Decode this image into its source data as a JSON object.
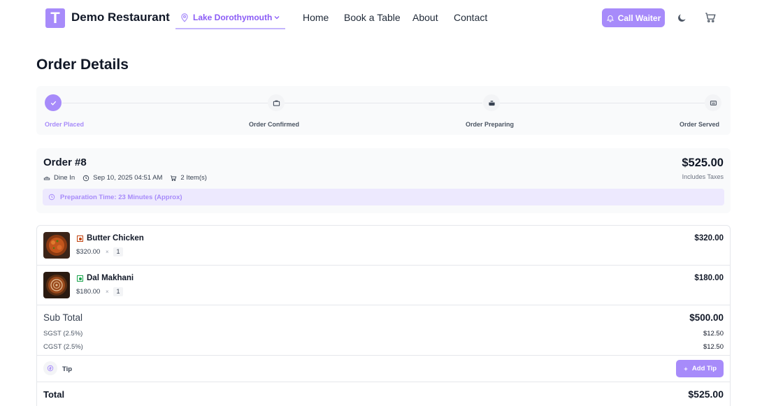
{
  "header": {
    "logo_letter": "T",
    "brand": "Demo Restaurant",
    "location": "Lake Dorothymouth",
    "nav": [
      "Home",
      "Book a Table",
      "About",
      "Contact"
    ],
    "call_waiter": "Call Waiter"
  },
  "page_title": "Order Details",
  "stepper": {
    "steps": [
      {
        "label": "Order Placed",
        "done": true
      },
      {
        "label": "Order Confirmed",
        "done": false
      },
      {
        "label": "Order Preparing",
        "done": false
      },
      {
        "label": "Order Served",
        "done": false
      }
    ]
  },
  "order": {
    "number": "Order #8",
    "type": "Dine In",
    "datetime": "Sep 10, 2025 04:51 AM",
    "items_count": "2 Item(s)",
    "amount": "$525.00",
    "includes": "Includes Taxes",
    "prep_time": "Preparation Time: 23 Minutes (Approx)"
  },
  "items": [
    {
      "name": "Butter Chicken",
      "price": "$320.00",
      "times": "×",
      "qty": "1",
      "total": "$320.00",
      "diet": "non-veg"
    },
    {
      "name": "Dal Makhani",
      "price": "$180.00",
      "times": "×",
      "qty": "1",
      "total": "$180.00",
      "diet": "veg"
    }
  ],
  "totals": {
    "sub_total_label": "Sub Total",
    "sub_total": "$500.00",
    "sgst_label": "SGST (2.5%)",
    "sgst": "$12.50",
    "cgst_label": "CGST (2.5%)",
    "cgst": "$12.50",
    "tip_label": "Tip",
    "add_tip": "Add Tip",
    "total_label": "Total",
    "total": "$525.00"
  },
  "colors": {
    "accent": "#a78bfa",
    "accent_light": "#ede9fe",
    "non_veg": "#c2410c",
    "veg": "#16a34a"
  }
}
